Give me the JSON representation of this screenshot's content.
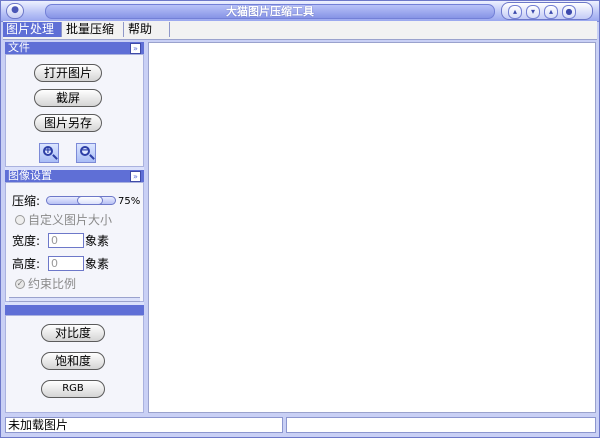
{
  "window": {
    "title": "大猫图片压缩工具"
  },
  "menubar": {
    "items": [
      "图片处理",
      "批量压缩",
      "帮助"
    ]
  },
  "file_section": {
    "title": "文件",
    "open_label": "打开图片",
    "capture_label": "截屏",
    "save_as_label": "图片另存"
  },
  "image_settings": {
    "title": "图像设置",
    "compress_label": "压缩:",
    "compress_value": "75%",
    "custom_size_label": "自定义图片大小",
    "width_label": "宽度:",
    "width_value": "0",
    "height_label": "高度:",
    "height_value": "0",
    "unit_label": "象素",
    "constrain_label": "约束比例"
  },
  "adjust_section": {
    "contrast_label": "对比度",
    "saturation_label": "饱和度",
    "rgb_label": "RGB"
  },
  "status": {
    "text": "未加载图片"
  },
  "colors": {
    "accent": "#5f6fd6",
    "panel": "#dbe1fb",
    "frame": "#c9d0f5"
  }
}
